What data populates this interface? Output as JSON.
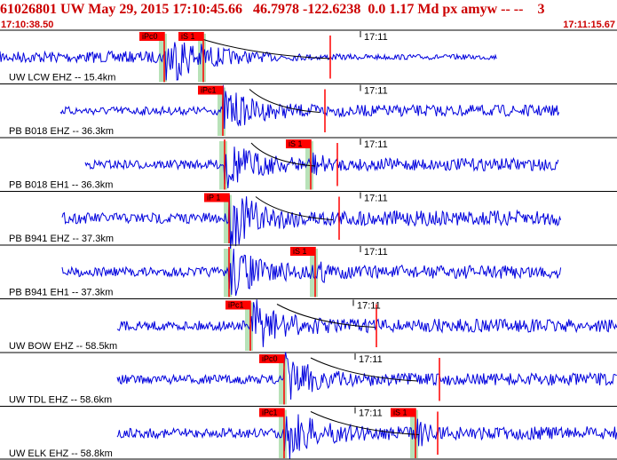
{
  "header": {
    "title": "61026801 UW May 29, 2015 17:10:45.66   46.7978 -122.6238  0.0 1.17 Md px amyw -- --    3",
    "start_time": "17:10:38.50",
    "end_time": "17:11:15.67"
  },
  "chart_data": {
    "type": "line",
    "x_range": [
      "17:10:38.50",
      "17:11:15.67"
    ],
    "minute_mark": "17:11",
    "colors": {
      "trace": "#0000dd",
      "pick": "#ff0000",
      "pick_window": "#b8e2b8",
      "moveout": "#000000",
      "divider": "#000000"
    },
    "traces": [
      {
        "label": "UW LCW EHZ -- 15.4km",
        "pick_labels": [
          "iPc0",
          "iS 1"
        ]
      },
      {
        "label": "PB B018 EHZ -- 36.3km",
        "pick_labels": [
          "iPc1",
          ""
        ]
      },
      {
        "label": "PB B018 EH1 -- 36.3km",
        "pick_labels": [
          "",
          "iS 1"
        ]
      },
      {
        "label": "PB B941 EHZ -- 37.3km",
        "pick_labels": [
          "iP 1",
          ""
        ]
      },
      {
        "label": "PB B941 EH1 -- 37.3km",
        "pick_labels": [
          "",
          "iS 1"
        ]
      },
      {
        "label": "UW BOW EHZ -- 58.5km",
        "pick_labels": [
          "iPc1",
          ""
        ]
      },
      {
        "label": "UW TDL EHZ -- 58.6km",
        "pick_labels": [
          "iPc0",
          ""
        ]
      },
      {
        "label": "UW ELK EHZ -- 58.8km",
        "pick_labels": [
          "iPc1",
          "iS 1"
        ]
      }
    ]
  }
}
